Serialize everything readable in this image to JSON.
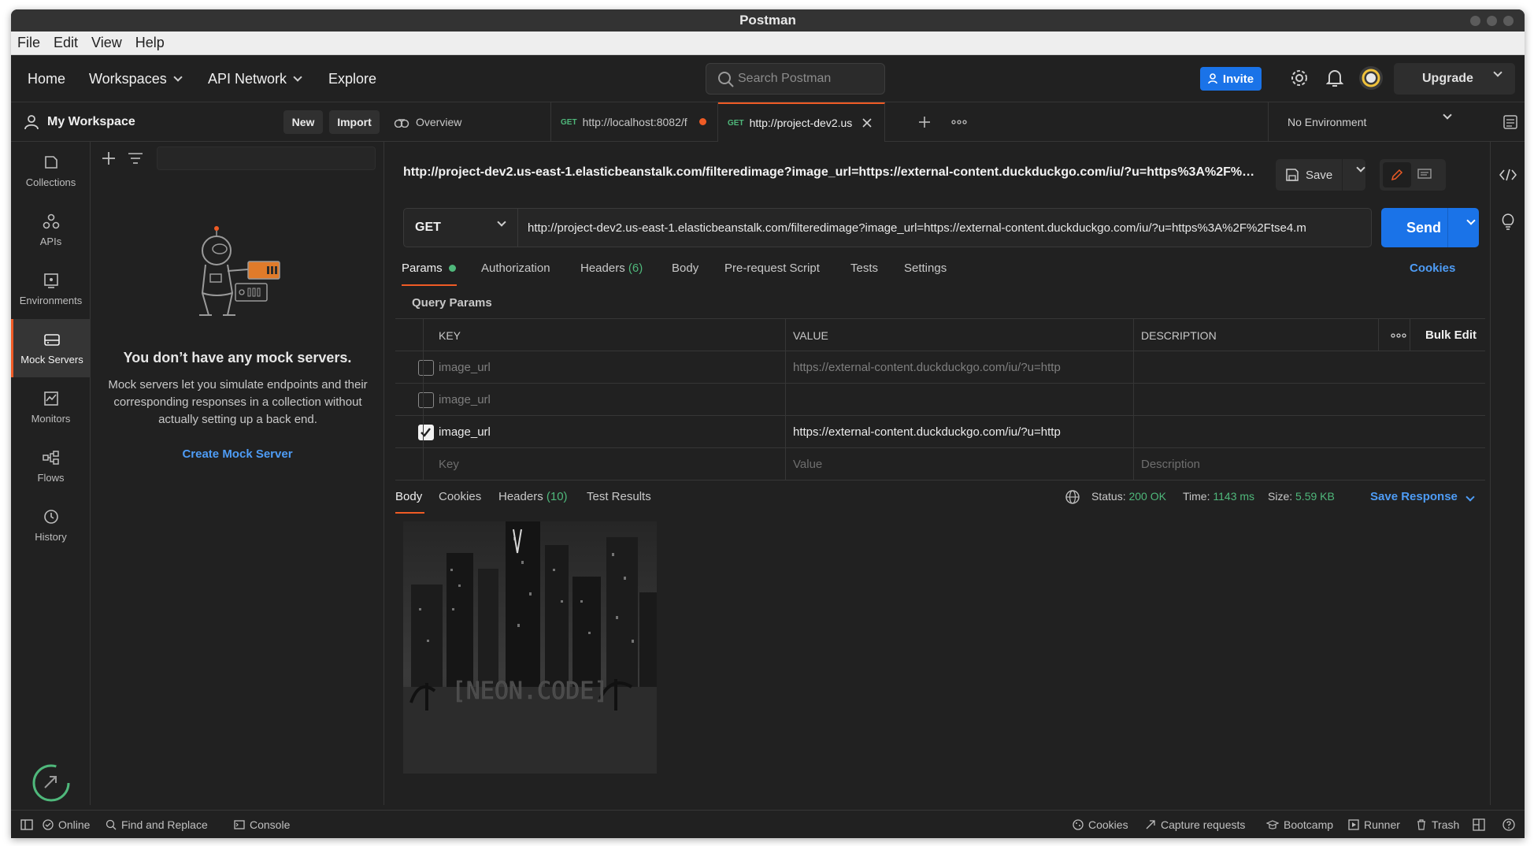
{
  "window": {
    "title": "Postman"
  },
  "menubar": [
    "File",
    "Edit",
    "View",
    "Help"
  ],
  "header": {
    "nav": {
      "home": "Home",
      "workspaces": "Workspaces",
      "api_network": "API Network",
      "explore": "Explore"
    },
    "search_placeholder": "Search Postman",
    "invite_label": "Invite",
    "upgrade_label": "Upgrade"
  },
  "workspace": {
    "name": "My Workspace",
    "new_label": "New",
    "import_label": "Import"
  },
  "sidebar": {
    "items": [
      {
        "label": "Collections",
        "icon": "collections-icon"
      },
      {
        "label": "APIs",
        "icon": "apis-icon"
      },
      {
        "label": "Environments",
        "icon": "environments-icon"
      },
      {
        "label": "Mock Servers",
        "icon": "mock-servers-icon",
        "active": true
      },
      {
        "label": "Monitors",
        "icon": "monitors-icon"
      },
      {
        "label": "Flows",
        "icon": "flows-icon"
      },
      {
        "label": "History",
        "icon": "history-icon"
      }
    ]
  },
  "mock_panel": {
    "empty_title": "You don’t have any mock servers.",
    "empty_desc": "Mock servers let you simulate endpoints and their corresponding responses in a collection without actually setting up a back end.",
    "create_label": "Create Mock Server"
  },
  "tabs": [
    {
      "label": "Overview",
      "method": ""
    },
    {
      "label": "http://localhost:8082/f",
      "method": "GET",
      "unsaved": true
    },
    {
      "label": "http://project-dev2.us",
      "method": "GET",
      "active": true
    }
  ],
  "environment": {
    "selected": "No Environment"
  },
  "request": {
    "name": "http://project-dev2.us-east-1.elasticbeanstalk.com/filteredimage?image_url=https://external-content.duckduckgo.com/iu/?u=https%3A%2F%2F...",
    "save_label": "Save",
    "method": "GET",
    "url": "http://project-dev2.us-east-1.elasticbeanstalk.com/filteredimage?image_url=https://external-content.duckduckgo.com/iu/?u=https%3A%2F%2Ftse4.m",
    "send_label": "Send"
  },
  "request_tabs": {
    "params": "Params",
    "authorization": "Authorization",
    "headers": "Headers",
    "headers_count": "(6)",
    "body": "Body",
    "prerequest": "Pre-request Script",
    "tests": "Tests",
    "settings": "Settings",
    "cookies": "Cookies"
  },
  "query_params": {
    "label": "Query Params",
    "columns": {
      "key": "KEY",
      "value": "VALUE",
      "description": "DESCRIPTION",
      "bulk_edit": "Bulk Edit"
    },
    "rows": [
      {
        "checked": false,
        "key": "image_url",
        "value": "https://external-content.duckduckgo.com/iu/?u=https%3...",
        "description": ""
      },
      {
        "checked": false,
        "key": "image_url",
        "value": "",
        "description": ""
      },
      {
        "checked": true,
        "key": "image_url",
        "value": "https://external-content.duckduckgo.com/iu/?u=https%3...",
        "description": ""
      }
    ],
    "placeholder": {
      "key": "Key",
      "value": "Value",
      "description": "Description"
    }
  },
  "response": {
    "tabs": {
      "body": "Body",
      "cookies": "Cookies",
      "headers": "Headers",
      "headers_count": "(10)",
      "test_results": "Test Results"
    },
    "status_label": "Status:",
    "status_value": "200 OK",
    "time_label": "Time:",
    "time_value": "1143 ms",
    "size_label": "Size:",
    "size_value": "5.59 KB",
    "save_response_label": "Save Response",
    "image_caption": "[NEON.CODE]"
  },
  "statusbar": {
    "online": "Online",
    "find_replace": "Find and Replace",
    "console": "Console",
    "cookies": "Cookies",
    "capture": "Capture requests",
    "bootcamp": "Bootcamp",
    "runner": "Runner",
    "trash": "Trash"
  },
  "colors": {
    "accent": "#ef5b25",
    "primary": "#1a73e8",
    "success": "#4fb87b",
    "link": "#4e9cf5",
    "background": "#212121"
  }
}
